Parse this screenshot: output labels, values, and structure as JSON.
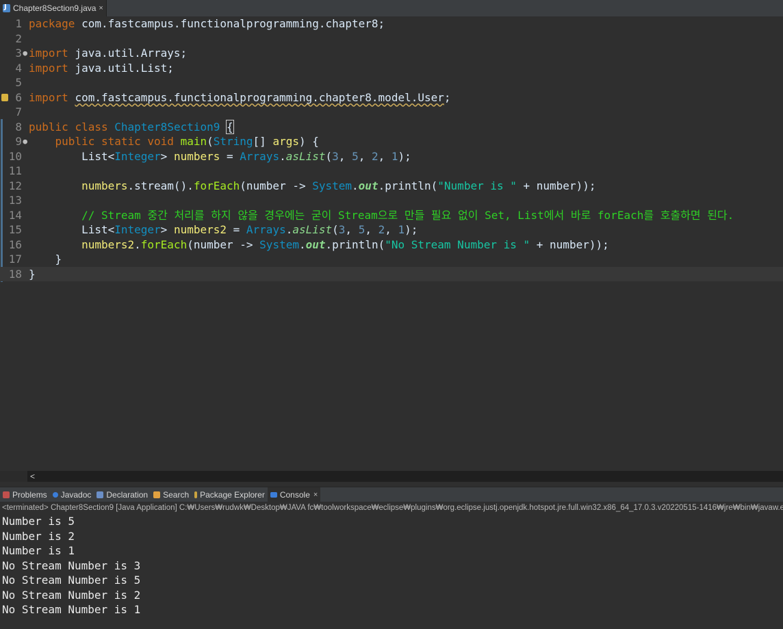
{
  "editor_tab": {
    "title": "Chapter8Section9.java",
    "close": "×",
    "icon": "java-file-icon"
  },
  "code_lines": [
    {
      "n": "1"
    },
    {
      "n": "2"
    },
    {
      "n": "3"
    },
    {
      "n": "4"
    },
    {
      "n": "5"
    },
    {
      "n": "6"
    },
    {
      "n": "7"
    },
    {
      "n": "8"
    },
    {
      "n": "9"
    },
    {
      "n": "10"
    },
    {
      "n": "11"
    },
    {
      "n": "12"
    },
    {
      "n": "13"
    },
    {
      "n": "14"
    },
    {
      "n": "15"
    },
    {
      "n": "16"
    },
    {
      "n": "17"
    },
    {
      "n": "18"
    }
  ],
  "code": {
    "l1": {
      "kw": "package",
      "rest": " com.fastcampus.functionalprogramming.chapter8;"
    },
    "l3": {
      "kw": "import",
      "rest": " java.util.Arrays;"
    },
    "l4": {
      "kw": "import",
      "rest": " java.util.List;"
    },
    "l6": {
      "kw": "import",
      "sp": " ",
      "path": "com.fastcampus.functionalprogramming.chapter8.model.User",
      "semi": ";"
    },
    "l8": {
      "kw1": "public",
      "kw2": "class",
      "cls": "Chapter8Section9",
      "brace": "{"
    },
    "l9": {
      "kw1": "public",
      "kw2": "static",
      "kw3": "void",
      "fn": "main",
      "p1": "(",
      "ty": "String",
      "p2": "[] ",
      "arg": "args",
      "p3": ") {"
    },
    "l10": {
      "a": "List<",
      "ty": "Integer",
      "b": "> ",
      "vr": "numbers",
      "c": " = ",
      "cls": "Arrays",
      "dot": ".",
      "sf": "asList",
      "d": "(",
      "n1": "3",
      "e": ", ",
      "n2": "5",
      "f": ", ",
      "n3": "2",
      "g": ", ",
      "n4": "1",
      "h": ");"
    },
    "l12": {
      "a": "numbers",
      "b": ".stream().",
      "fn": "forEach",
      "c": "(number -> ",
      "cls": "System",
      "dot": ".",
      "ob": "out",
      "d": ".println(",
      "st": "\"Number is \"",
      "e": " + number));"
    },
    "l14": {
      "cm": "// Stream 중간 처리를 하지 않을 경우에는 굳이 Stream으로 만들 필요 없이 Set, List에서 바로 forEach를 호출하면 된다."
    },
    "l15": {
      "a": "List<",
      "ty": "Integer",
      "b": "> ",
      "vr": "numbers2",
      "c": " = ",
      "cls": "Arrays",
      "dot": ".",
      "sf": "asList",
      "d": "(",
      "n1": "3",
      "e": ", ",
      "n2": "5",
      "f": ", ",
      "n3": "2",
      "g": ", ",
      "n4": "1",
      "h": ");"
    },
    "l16": {
      "a": "numbers2",
      "b": ".",
      "fn": "forEach",
      "c": "(number -> ",
      "cls": "System",
      "dot": ".",
      "ob": "out",
      "d": ".println(",
      "st": "\"No Stream Number is \"",
      "e": " + number));"
    },
    "l17": {
      "a": "}"
    },
    "l18": {
      "a": "}"
    }
  },
  "scroll_left": "<",
  "views": [
    {
      "label": "Problems",
      "icon": "problems-icon",
      "color": "#c0504d"
    },
    {
      "label": "Javadoc",
      "icon": "javadoc-icon",
      "color": "#3b7dd8"
    },
    {
      "label": "Declaration",
      "icon": "declaration-icon",
      "color": "#6b8fc7"
    },
    {
      "label": "Search",
      "icon": "search-icon",
      "color": "#e0a040"
    },
    {
      "label": "Package Explorer",
      "icon": "package-explorer-icon",
      "color": "#c9a340"
    },
    {
      "label": "Console",
      "icon": "console-icon",
      "color": "#3b7dd8",
      "close": "×"
    }
  ],
  "console_status": "<terminated> Chapter8Section9 [Java Application] C:₩Users₩rudwk₩Desktop₩JAVA fc₩toolworkspace₩eclipse₩plugins₩org.eclipse.justj.openjdk.hotspot.jre.full.win32.x86_64_17.0.3.v20220515-1416₩jre₩bin₩javaw.exe",
  "console_lines": [
    "Number is 5",
    "Number is 2",
    "Number is 1",
    "No Stream Number is 3",
    "No Stream Number is 5",
    "No Stream Number is 2",
    "No Stream Number is 1"
  ]
}
